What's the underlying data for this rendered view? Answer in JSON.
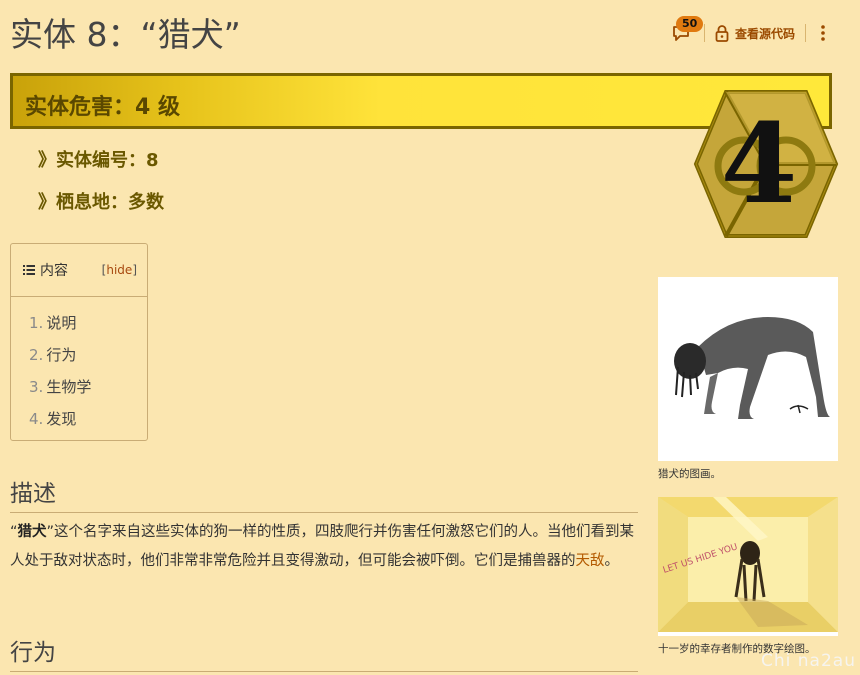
{
  "page": {
    "title": "实体 8：“猎犬”"
  },
  "toolbar": {
    "talk_count": "50",
    "view_source": "查看源代码"
  },
  "banner": {
    "hazard": "实体危害：4 级",
    "level_number": "4"
  },
  "info": {
    "entity_number": "》实体编号：8",
    "habitat": "》栖息地：多数"
  },
  "toc": {
    "title": "内容",
    "hide": "hide",
    "items": [
      {
        "num": "1.",
        "label": "说明"
      },
      {
        "num": "2.",
        "label": "行为"
      },
      {
        "num": "3.",
        "label": "生物学"
      },
      {
        "num": "4.",
        "label": "发现"
      }
    ]
  },
  "sections": {
    "description": {
      "heading": "描述",
      "bold_name": "猎犬",
      "text_a": "”这个名字来自这些实体的狗一样的性质，四肢爬行并伤害任何激怒它们的人。当他们看到某人处于敌对状态时，他们非常非常危险并且变得激动，但可能会被吓倒。它们是捕兽器的",
      "link": "天敌",
      "text_b": "。"
    },
    "behavior": {
      "heading": "行为"
    }
  },
  "figures": [
    {
      "caption": "猎犬的图画。"
    },
    {
      "caption": "十一岁的幸存者制作的数字绘图。",
      "wall_text": "LET US  HIDE YOU"
    }
  ],
  "watermark": "Chi na2au",
  "colors": {
    "background": "#fbe6b0",
    "banner": "#ffe33a",
    "accent": "#b35a00"
  }
}
